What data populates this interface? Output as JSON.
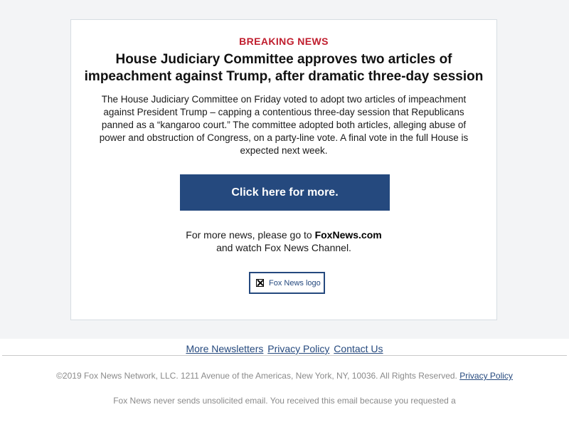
{
  "email": {
    "kicker": "BREAKING NEWS",
    "headline": "House Judiciary Committee approves two articles of impeachment against Trump, after dramatic three-day session",
    "body": "The House Judiciary Committee on Friday voted to adopt two articles of impeachment against President Trump – capping a contentious three-day session that Republicans panned as a “kangaroo court.” The committee adopted both articles, alleging abuse of power and obstruction of Congress, on a party-line vote. A final vote in the full House is expected next week.",
    "cta_label": "Click here for more.",
    "more_news_prefix": "For more news, please go to ",
    "more_news_site": "FoxNews.com",
    "more_news_suffix": "and watch Fox News Channel.",
    "logo_alt": "Fox News logo",
    "logo_icon": "broken-image-icon"
  },
  "footer": {
    "links": [
      "More Newsletters",
      "Privacy Policy",
      "Contact Us"
    ],
    "copyright": "©2019 Fox News Network, LLC. 1211 Avenue of the Americas, New York, NY, 10036. All Rights Reserved.",
    "copyright_link": "Privacy Policy",
    "disclaimer": "Fox News never sends unsolicited email. You received this email because you requested a"
  },
  "colors": {
    "kicker": "#c01e2e",
    "brand_blue": "#25497e",
    "band_background": "#f3f4f6"
  }
}
